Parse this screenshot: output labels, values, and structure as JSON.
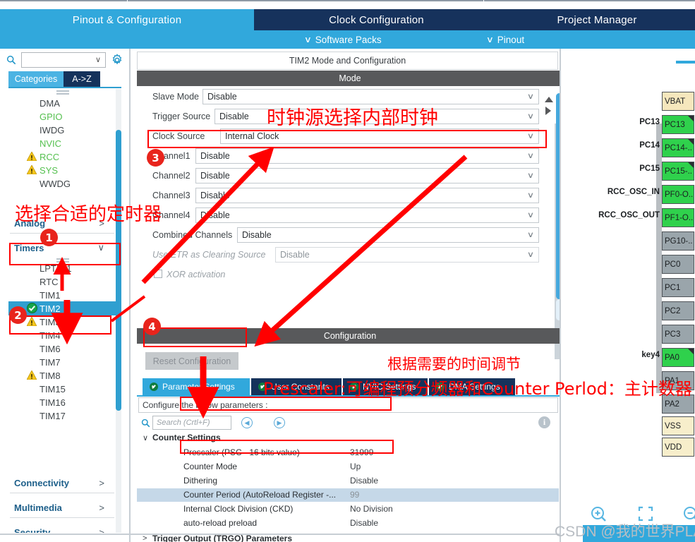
{
  "app": {
    "main_tabs": [
      {
        "label": "Pinout & Configuration",
        "active": true
      },
      {
        "label": "Clock Configuration",
        "active": false
      },
      {
        "label": "Project Manager",
        "active": false
      }
    ],
    "sub_tabs": [
      {
        "label": "Software Packs",
        "icon": "chevron-down-icon"
      },
      {
        "label": "Pinout",
        "icon": "chevron-down-icon"
      }
    ]
  },
  "sidebar": {
    "search": {
      "value": "",
      "placeholder": ""
    },
    "gear_icon": "gear-icon",
    "view_tabs": [
      {
        "label": "Categories",
        "selected": true
      },
      {
        "label": "A->Z",
        "selected": false
      }
    ],
    "system_peripherals": [
      {
        "label": "DMA",
        "state": "normal",
        "color": "#3f4549"
      },
      {
        "label": "GPIO",
        "state": "ok",
        "color": "#55c04f"
      },
      {
        "label": "IWDG",
        "state": "normal",
        "color": "#3f4549"
      },
      {
        "label": "NVIC",
        "state": "ok",
        "color": "#55c04f"
      },
      {
        "label": "RCC",
        "state": "warning",
        "color": "#55c04f"
      },
      {
        "label": "SYS",
        "state": "warning",
        "color": "#55c04f"
      },
      {
        "label": "WWDG",
        "state": "normal",
        "color": "#3f4549"
      }
    ],
    "group_analog": {
      "label": "Analog",
      "chevron": "chevron-right-icon"
    },
    "group_timers": {
      "label": "Timers",
      "chevron": "chevron-down-icon"
    },
    "timers": [
      {
        "label": "LPTIM1",
        "state": "normal",
        "selected": false
      },
      {
        "label": "RTC",
        "state": "normal",
        "selected": false
      },
      {
        "label": "TIM1",
        "state": "normal",
        "selected": false
      },
      {
        "label": "TIM2",
        "state": "ok",
        "selected": true
      },
      {
        "label": "TIM3",
        "state": "warning",
        "selected": false
      },
      {
        "label": "TIM4",
        "state": "normal",
        "selected": false
      },
      {
        "label": "TIM6",
        "state": "normal",
        "selected": false
      },
      {
        "label": "TIM7",
        "state": "normal",
        "selected": false
      },
      {
        "label": "TIM8",
        "state": "warning",
        "selected": false
      },
      {
        "label": "TIM15",
        "state": "normal",
        "selected": false
      },
      {
        "label": "TIM16",
        "state": "normal",
        "selected": false
      },
      {
        "label": "TIM17",
        "state": "normal",
        "selected": false
      }
    ],
    "group_connectivity": {
      "label": "Connectivity",
      "chevron": "chevron-right-icon"
    },
    "group_multimedia": {
      "label": "Multimedia",
      "chevron": "chevron-right-icon"
    },
    "group_security": {
      "label": "Security",
      "chevron": "chevron-right-icon"
    }
  },
  "center": {
    "panel_title": "TIM2 Mode and Configuration",
    "mode_header": "Mode",
    "mode_fields": [
      {
        "label": "Slave Mode",
        "value": "Disable",
        "disabled": false
      },
      {
        "label": "Trigger Source",
        "value": "Disable",
        "disabled": false
      },
      {
        "label": "Clock Source",
        "value": "Internal Clock",
        "disabled": false
      },
      {
        "label": "Channel1",
        "value": "Disable",
        "disabled": false
      },
      {
        "label": "Channel2",
        "value": "Disable",
        "disabled": false
      },
      {
        "label": "Channel3",
        "value": "Disable",
        "disabled": false
      },
      {
        "label": "Channel4",
        "value": "Disable",
        "disabled": false
      },
      {
        "label": "Combined Channels",
        "value": "Disable",
        "disabled": false
      },
      {
        "label": "Use ETR as Clearing Source",
        "value": "Disable",
        "disabled": true
      }
    ],
    "xor_activation": "XOR activation",
    "config_header": "Configuration",
    "reset_button": "Reset Configuration",
    "config_tabs": [
      {
        "label": "Parameter Settings",
        "selected": true
      },
      {
        "label": "User Constants",
        "selected": false
      },
      {
        "label": "NVIC Settings",
        "selected": false
      },
      {
        "label": "DMA Settings",
        "selected": false
      }
    ],
    "configure_hint": "Configure the below parameters :",
    "param_search": {
      "value": "",
      "placeholder": "Search (Crtl+F)"
    },
    "nav_prev_icon": "circle-left-icon",
    "nav_next_icon": "circle-right-icon",
    "info_icon": "info-icon",
    "tree": [
      {
        "kind": "group",
        "label": "Counter Settings",
        "expanded": true
      },
      {
        "kind": "param",
        "label": "Prescaler (PSC - 16 bits value)",
        "value": "31999",
        "highlight": false
      },
      {
        "kind": "param",
        "label": "Counter Mode",
        "value": "Up",
        "highlight": false
      },
      {
        "kind": "param",
        "label": "Dithering",
        "value": "Disable",
        "highlight": false
      },
      {
        "kind": "param",
        "label": "Counter Period (AutoReload Register -...",
        "value": "99",
        "highlight": true
      },
      {
        "kind": "param",
        "label": "Internal Clock Division (CKD)",
        "value": "No Division",
        "highlight": false
      },
      {
        "kind": "param",
        "label": "auto-reload preload",
        "value": "Disable",
        "highlight": false
      },
      {
        "kind": "group",
        "label": "Trigger Output (TRGO) Parameters",
        "expanded": false
      }
    ]
  },
  "pinout": {
    "pins": [
      {
        "label": "",
        "name": "VBAT",
        "style": "vbat"
      },
      {
        "label": "PC13",
        "name": "PC13",
        "style": "green"
      },
      {
        "label": "PC14",
        "name": "PC14-..",
        "style": "green"
      },
      {
        "label": "PC15",
        "name": "PC15-..",
        "style": "green"
      },
      {
        "label": "RCC_OSC_IN",
        "name": "PF0-O..",
        "style": "green"
      },
      {
        "label": "RCC_OSC_OUT",
        "name": "PF1-O..",
        "style": "green"
      },
      {
        "label": "",
        "name": "PG10-..",
        "style": "gray"
      },
      {
        "label": "",
        "name": "PC0",
        "style": "gray"
      },
      {
        "label": "",
        "name": "PC1",
        "style": "gray"
      },
      {
        "label": "",
        "name": "PC2",
        "style": "gray"
      },
      {
        "label": "",
        "name": "PC3",
        "style": "gray"
      },
      {
        "label": "key4",
        "name": "PA0",
        "style": "green"
      },
      {
        "label": "",
        "name": "PA1",
        "style": "gray"
      },
      {
        "label": "",
        "name": "PA2",
        "style": "gray"
      },
      {
        "label": "",
        "name": "VSS",
        "style": "pwr"
      },
      {
        "label": "",
        "name": "VDD",
        "style": "pwr"
      }
    ],
    "zoom_tools": [
      {
        "icon": "zoom-in-icon"
      },
      {
        "icon": "zoom-fit-icon"
      },
      {
        "icon": "zoom-out-icon"
      }
    ]
  },
  "annotations": {
    "text_select_timer": "选择合适的定时器",
    "text_clock_source": "时钟源选择内部时钟",
    "text_time_adjust": "根据需要的时间调节",
    "text_prescaler_desc": "Prescaler:可编程预分频器和Counter Perlod：主计数器",
    "badges": [
      "1",
      "2",
      "3",
      "4"
    ],
    "accent_color": "#ff0000"
  },
  "watermark": "CSDN @我的世界PLA"
}
